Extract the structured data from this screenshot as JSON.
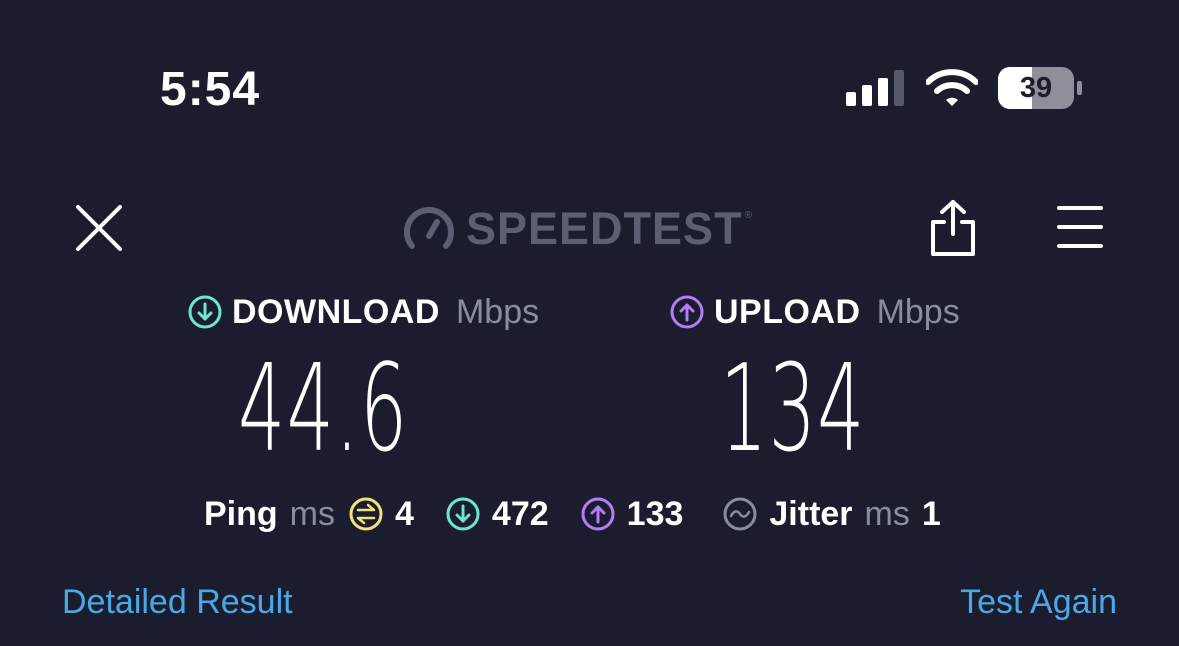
{
  "status_bar": {
    "time": "5:54",
    "battery_level": "39"
  },
  "header": {
    "logo_text": "SPEEDTEST",
    "logo_tm": "®"
  },
  "download": {
    "label": "DOWNLOAD",
    "unit": "Mbps",
    "value": "44.6",
    "color": "#6fe3d4"
  },
  "upload": {
    "label": "UPLOAD",
    "unit": "Mbps",
    "value": "134",
    "color": "#b57cf5"
  },
  "stats": {
    "ping_label": "Ping",
    "ping_unit": "ms",
    "ping_idle": "4",
    "ping_download": "472",
    "ping_upload": "133",
    "jitter_label": "Jitter",
    "jitter_unit": "ms",
    "jitter_value": "1",
    "ping_color": "#f2e27a"
  },
  "actions": {
    "detailed_result": "Detailed Result",
    "test_again": "Test Again",
    "link_color": "#4aa8e6"
  },
  "icons": [
    "close-icon",
    "share-icon",
    "menu-icon",
    "download-arrow-icon",
    "upload-arrow-icon",
    "ping-icon",
    "jitter-icon",
    "speedtest-gauge-icon",
    "signal-icon",
    "wifi-icon",
    "battery-icon"
  ]
}
